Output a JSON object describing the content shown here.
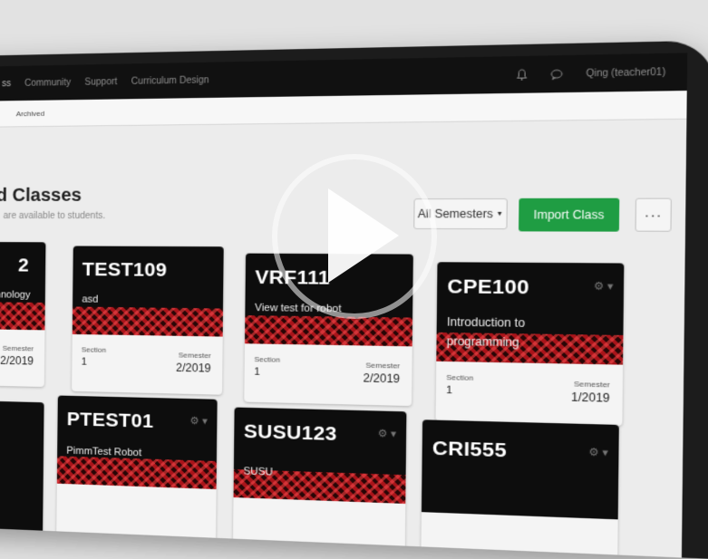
{
  "nav": {
    "items": [
      "ss",
      "Community",
      "Support",
      "Curriculum Design"
    ],
    "user": "Qing (teacher01)"
  },
  "subnav": {
    "tab": "Archived"
  },
  "page": {
    "title": "d Classes",
    "subtitle": "are available to students."
  },
  "actions": {
    "semesters": "All Semesters",
    "import": "Import Class",
    "more": "···"
  },
  "cards": [
    {
      "code": "2",
      "desc": "Technology",
      "section_label": "",
      "section": "",
      "semester_label": "Semester",
      "semester": "2/2019"
    },
    {
      "code": "TEST109",
      "desc": "asd",
      "section_label": "Section",
      "section": "1",
      "semester_label": "Semester",
      "semester": "2/2019"
    },
    {
      "code": "VRF111",
      "desc": "View test for robot",
      "section_label": "Section",
      "section": "1",
      "semester_label": "Semester",
      "semester": "2/2019"
    },
    {
      "code": "CPE100",
      "desc": "Introduction to programming",
      "section_label": "Section",
      "section": "1",
      "semester_label": "Semester",
      "semester": "1/2019"
    },
    {
      "code": "PTEST01",
      "desc": "PimmTest Robot",
      "section_label": "",
      "section": "",
      "semester_label": "",
      "semester": ""
    },
    {
      "code": "SUSU123",
      "desc": "SUSU",
      "section_label": "",
      "section": "",
      "semester_label": "",
      "semester": ""
    },
    {
      "code": "CRI555",
      "desc": "",
      "section_label": "",
      "section": "",
      "semester_label": "",
      "semester": ""
    }
  ],
  "icons": {
    "gear": "gear-icon",
    "bell": "bell-icon",
    "chat": "chat-icon",
    "play": "play-icon"
  },
  "colors": {
    "nav_bg": "#111111",
    "import_green": "#1f9d43",
    "card_dark": "#0d0d0d",
    "pattern_red": "#b3161c"
  }
}
